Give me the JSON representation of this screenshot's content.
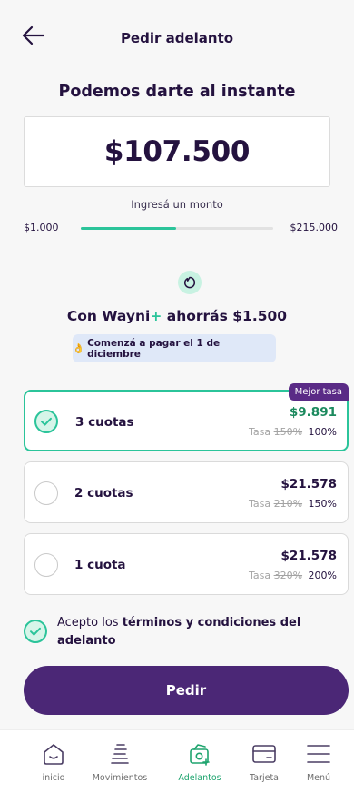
{
  "header": {
    "title": "Pedir adelanto",
    "back_icon": "arrow-left-icon"
  },
  "headline": "Podemos darte al instante",
  "amount": {
    "value": "$107.500",
    "hint": "Ingresá un monto",
    "min_label": "$1.000",
    "max_label": "$215.000",
    "slider_fraction": 0.497
  },
  "savings": {
    "prefix": "Con Wayni",
    "plus": "+",
    "suffix": " ahorrás $1.500",
    "pay_start_icon": "👌",
    "pay_start": "Comenzá a pagar el 1 de diciembre"
  },
  "options": [
    {
      "label": "3 cuotas",
      "amount": "$9.891",
      "rate_word": "Tasa",
      "rate_old": "150%",
      "rate_new": "100%",
      "selected": true,
      "badge": "Mejor tasa"
    },
    {
      "label": "2 cuotas",
      "amount": "$21.578",
      "rate_word": "Tasa",
      "rate_old": "210%",
      "rate_new": "150%",
      "selected": false
    },
    {
      "label": "1 cuota",
      "amount": "$21.578",
      "rate_word": "Tasa",
      "rate_old": "320%",
      "rate_new": "200%",
      "selected": false
    }
  ],
  "terms": {
    "prefix": "Acepto los ",
    "link": "términos y condiciones del adelanto",
    "checked": true
  },
  "submit_label": "Pedir",
  "nav": [
    {
      "label": "inicio",
      "icon": "home-icon",
      "active": false
    },
    {
      "label": "Movimientos",
      "icon": "list-icon",
      "active": false
    },
    {
      "label": "Adelantos",
      "icon": "advance-icon",
      "active": true
    },
    {
      "label": "Tarjeta",
      "icon": "card-icon",
      "active": false
    },
    {
      "label": "Menú",
      "icon": "menu-icon",
      "active": false
    }
  ],
  "colors": {
    "primary": "#4b2776",
    "accent": "#2bc49a",
    "text": "#24123f",
    "badge": "#5a2b86"
  }
}
